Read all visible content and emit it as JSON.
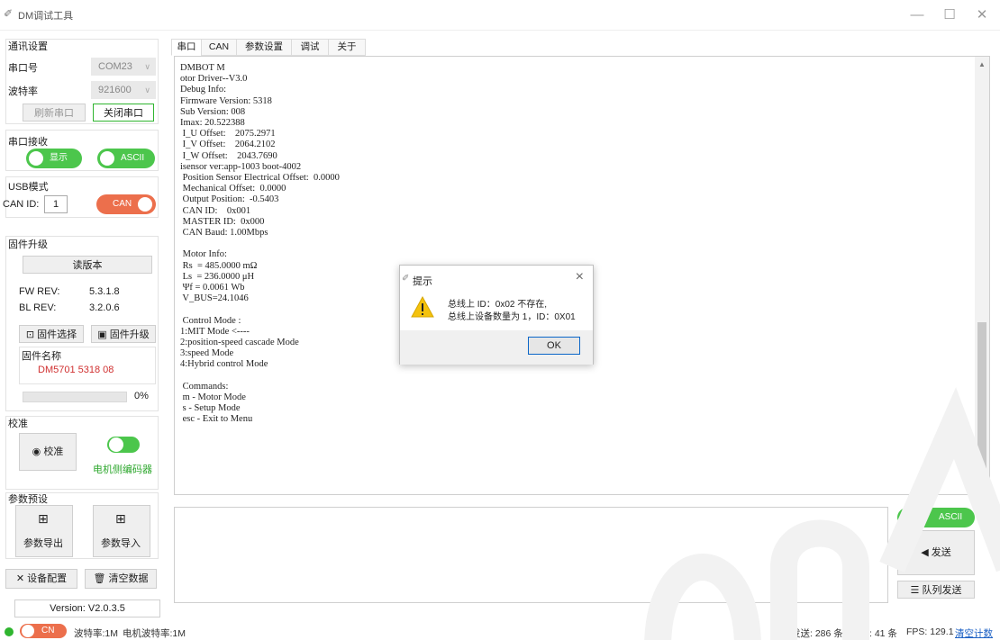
{
  "window": {
    "title": "DM调试工具",
    "min": "—",
    "max": "☐",
    "close": "✕"
  },
  "comm": {
    "title": "通讯设置",
    "port_label": "串口号",
    "port_value": "COM23",
    "baud_label": "波特率",
    "baud_value": "921600",
    "refresh_label": "刷新串口",
    "close_port_label": "关闭串口"
  },
  "serial_rx": {
    "title": "串口接收",
    "display_toggle": "显示",
    "ascii_toggle": "ASCII"
  },
  "usb": {
    "title": "USB模式",
    "can_id_label": "CAN ID:",
    "can_id_value": "1",
    "can_toggle": "CAN"
  },
  "firmware": {
    "title": "固件升级",
    "read_version": "读版本",
    "fw_rev_label": "FW REV:",
    "fw_rev_value": "5.3.1.8",
    "bl_rev_label": "BL REV:",
    "bl_rev_value": "3.2.0.6",
    "select_label": "固件选择",
    "upgrade_label": "固件升级",
    "name_label": "固件名称",
    "name_value": "DM5701 5318 08",
    "progress_text": "0%",
    "progress": 0
  },
  "calib": {
    "title": "校准",
    "calib_button": "校准",
    "encoder_toggle": "电机侧编码器"
  },
  "presets": {
    "title": "参数预设",
    "export_label": "参数导出",
    "import_label": "参数导入"
  },
  "actions": {
    "device_config": "设备配置",
    "clear_data": "清空数据"
  },
  "version": "Version: V2.0.3.5",
  "tabs": [
    {
      "label": "串口"
    },
    {
      "label": "CAN"
    },
    {
      "label": "参数设置"
    },
    {
      "label": "调试"
    },
    {
      "label": "关于"
    }
  ],
  "console_lines": [
    "DMBOT M",
    "otor Driver--V3.0",
    "Debug Info:",
    "Firmware Version: 5318",
    "Sub Version: 008",
    "Imax: 20.522388",
    " I_U Offset:    2075.2971",
    " I_V Offset:    2064.2102",
    " I_W Offset:    2043.7690",
    "isensor ver:app-1003 boot-4002",
    " Position Sensor Electrical Offset:  0.0000",
    " Mechanical Offset:  0.0000",
    " Output Position:  -0.5403",
    " CAN ID:    0x001",
    " MASTER ID:  0x000",
    " CAN Baud: 1.00Mbps",
    "",
    " Motor Info:",
    " Rs  = 485.0000 mΩ",
    " Ls  = 236.0000 μH",
    " Ψf = 0.0061 Wb",
    " V_BUS=24.1046",
    "",
    " Control Mode :",
    "1:MIT Mode <----",
    "2:position-speed cascade Mode",
    "3:speed Mode",
    "4:Hybrid control Mode",
    "",
    " Commands:",
    " m - Motor Mode",
    " s - Setup Mode",
    " esc - Exit to Menu"
  ],
  "send": {
    "ascii_toggle": "ASCII",
    "send_label": "发送",
    "queue_label": "队列发送"
  },
  "statusbar": {
    "cn_toggle": "CN",
    "baud_text": "波特率:1M",
    "motor_baud_text": "电机波特率:1M",
    "sent_text": "发送: 286 条",
    "recv_text": "接收: 41 条",
    "fps_text": "FPS: 129.1",
    "clear_counts": "清空计数"
  },
  "dialog": {
    "title": "提示",
    "line1": "总线上 ID：0x02 不存在,",
    "line2": "总线上设备数量为 1，ID：0X01",
    "ok": "OK"
  },
  "colors": {
    "green": "#4cc64c",
    "orange": "#ec6f4c",
    "red_text": "#d03030",
    "link": "#1a5fc4"
  }
}
